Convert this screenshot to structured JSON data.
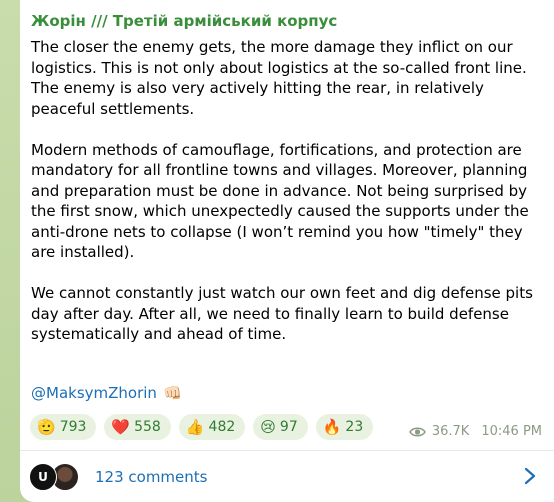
{
  "post": {
    "channel_name": "Жорін /// Третій армійський корпус",
    "text": "The closer the enemy gets, the more damage they inflict on our logistics. This is not only about logistics at the so-called front line. The enemy is also very actively hitting the rear, in relatively peaceful settlements.\n\nModern methods of camouflage, fortifications, and protection are mandatory for all frontline towns and villages. Moreover, planning and preparation must be done in advance. Not being surprised by the first snow, which unexpectedly caused the supports under the anti-drone nets to collapse (I won’t remind you how \"timely\" they are installed).\n\nWe cannot constantly just watch our own feet and dig defense pits day after day. After all, we need to finally learn to build defense systematically and ahead of time.",
    "mention": "@MaksymZhorin",
    "mention_emoji": "👊🏻"
  },
  "reactions": [
    {
      "emoji": "🫡",
      "count": "793",
      "icon": "salute-icon"
    },
    {
      "emoji": "❤️",
      "count": "558",
      "icon": "heart-icon"
    },
    {
      "emoji": "👍",
      "count": "482",
      "icon": "thumbs-up-icon"
    },
    {
      "emoji": "😢",
      "count": "97",
      "icon": "crying-face-icon"
    },
    {
      "emoji": "🔥",
      "count": "23",
      "icon": "fire-icon"
    }
  ],
  "meta": {
    "views": "36.7K",
    "time": "10:46 PM"
  },
  "comments": {
    "label": "123 comments",
    "avatar_letter": "U"
  },
  "colors": {
    "channel_name": "#3a8e3b",
    "link": "#1d6fb5",
    "reaction_bg": "#e9f1e0",
    "background": "#c5d9a7"
  }
}
